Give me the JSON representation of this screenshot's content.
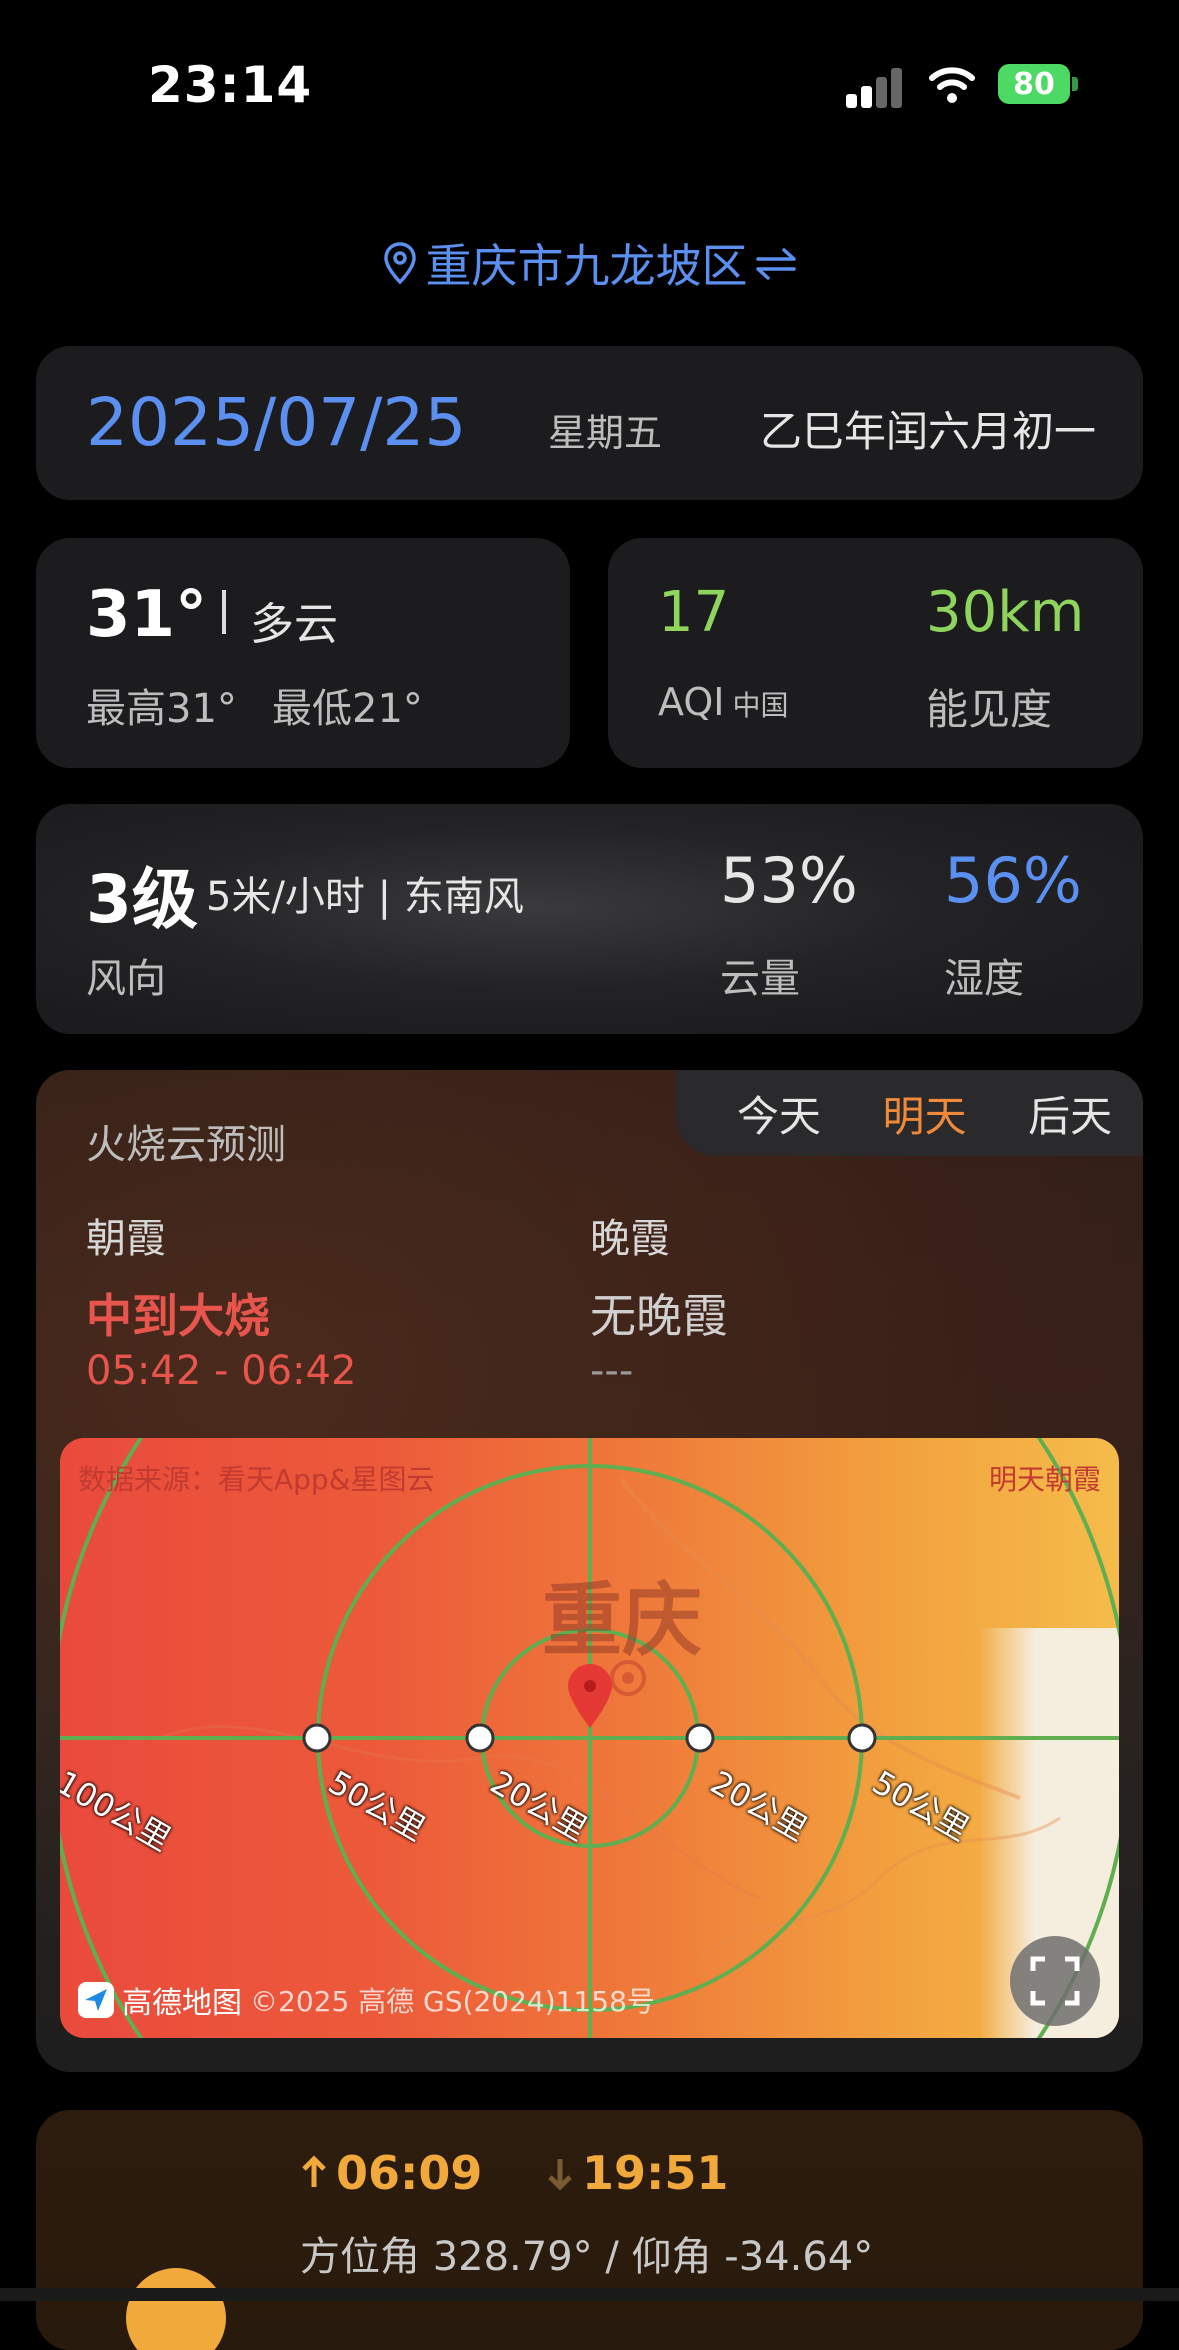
{
  "status_bar": {
    "time": "23:14",
    "battery": "80",
    "battery_color": "#4cd964"
  },
  "location": {
    "name": "重庆市九龙坡区",
    "color": "#5b8ff0"
  },
  "date": {
    "main": "2025/07/25",
    "weekday": "星期五",
    "lunar": "乙巳年闰六月初一"
  },
  "weather": {
    "temp_now": "31°",
    "desc": "多云",
    "high": "最高31°",
    "low": "最低21°"
  },
  "air": {
    "aqi_value": "17",
    "aqi_label": "AQI",
    "aqi_sub": "中国",
    "visibility_value": "30km",
    "visibility_label": "能见度",
    "value_color": "#8fd45d"
  },
  "wind": {
    "level": "3级",
    "detail": "5米/小时 | 东南风",
    "label": "风向",
    "cloud_value": "53%",
    "cloud_label": "云量",
    "humidity_value": "56%",
    "humidity_label": "湿度"
  },
  "fire_cloud": {
    "title": "火烧云预测",
    "tabs": [
      {
        "label": "今天",
        "active": false
      },
      {
        "label": "明天",
        "active": true
      },
      {
        "label": "后天",
        "active": false
      }
    ],
    "morning": {
      "label": "朝霞",
      "value": "中到大烧",
      "time": "05:42 - 06:42"
    },
    "evening": {
      "label": "晚霞",
      "value": "无晚霞",
      "time": "---"
    },
    "map": {
      "source": "数据来源：看天App&星图云",
      "mode": "明天朝霞",
      "city": "重庆",
      "ring_labels": [
        "100公里",
        "50公里",
        "20公里",
        "20公里",
        "50公里"
      ],
      "provider": "高德地图",
      "copyright": "©2025 高德 GS(2024)1158号"
    }
  },
  "sun": {
    "sunrise": "06:09",
    "sunset": "19:51",
    "angle": "方位角 328.79° / 仰角 -34.64°"
  }
}
